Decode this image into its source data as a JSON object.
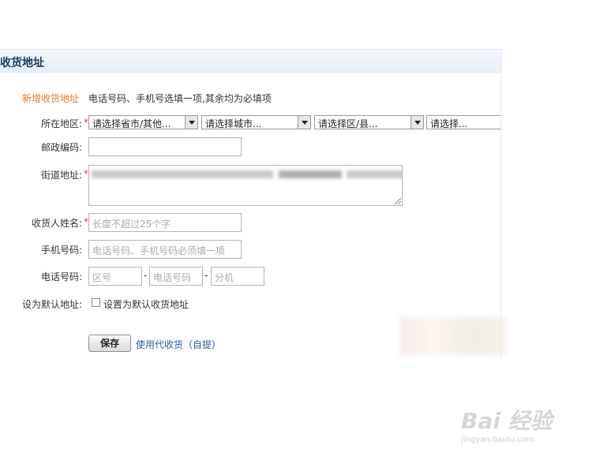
{
  "panel": {
    "title": "收货地址"
  },
  "form": {
    "heading": "新增收货地址",
    "tip": "电话号码、手机号选填一项,其余均为必填项",
    "region": {
      "label": "所在地区:",
      "selects": [
        "请选择省市/其他...",
        "请选择城市...",
        "请选择区/县...",
        "请选择..."
      ]
    },
    "postcode": {
      "label": "邮政编码:",
      "value": ""
    },
    "street": {
      "label": "街道地址:"
    },
    "name": {
      "label": "收货人姓名:",
      "placeholder": "长度不超过25个字"
    },
    "mobile": {
      "label": "手机号码:",
      "placeholder": "电话号码、手机号码必须填一项"
    },
    "phone": {
      "label": "电话号码:",
      "area_placeholder": "区号",
      "number_placeholder": "电话号码",
      "ext_placeholder": "分机",
      "sep": "-"
    },
    "default": {
      "label": "设为默认地址:",
      "checkbox_label": "设置为默认收货地址"
    },
    "required_mark": "*"
  },
  "actions": {
    "save_label": "保存",
    "pickup_link": "使用代收货（自提）"
  },
  "watermark": {
    "main": "Bai 经验",
    "sub": "jingyan.baidu.com"
  }
}
